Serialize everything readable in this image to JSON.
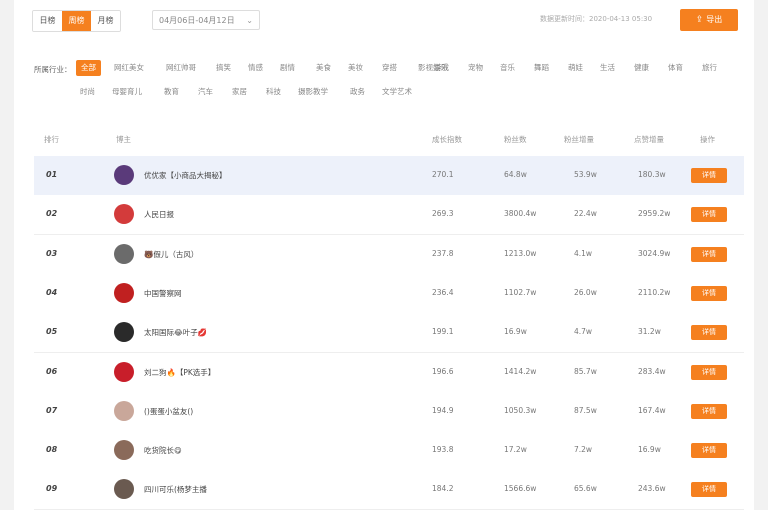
{
  "toolbar": {
    "tabs": [
      {
        "label": "日榜",
        "active": false
      },
      {
        "label": "周榜",
        "active": true
      },
      {
        "label": "月榜",
        "active": false
      }
    ],
    "date_range": "04月06日-04月12日",
    "update_time": "数据更新时间：2020-04-13 05:30",
    "export_label": "导出"
  },
  "filters": {
    "label": "所属行业：",
    "chips": [
      {
        "label": "全部",
        "active": true
      },
      {
        "label": "网红美女"
      },
      {
        "label": "网红帅哥"
      },
      {
        "label": "搞笑"
      },
      {
        "label": "情感"
      },
      {
        "label": "剧情"
      },
      {
        "label": "美食"
      },
      {
        "label": "美妆"
      },
      {
        "label": "穿搭"
      },
      {
        "label": "影视娱乐"
      },
      {
        "label": "游戏"
      },
      {
        "label": "宠物"
      },
      {
        "label": "音乐"
      },
      {
        "label": "舞蹈"
      },
      {
        "label": "萌娃"
      },
      {
        "label": "生活"
      },
      {
        "label": "健康"
      },
      {
        "label": "体育"
      },
      {
        "label": "旅行"
      },
      {
        "label": "时尚"
      },
      {
        "label": "母婴育儿"
      },
      {
        "label": "教育"
      },
      {
        "label": "汽车"
      },
      {
        "label": "家居"
      },
      {
        "label": "科技"
      },
      {
        "label": "摄影教学"
      },
      {
        "label": "政务"
      },
      {
        "label": "文学艺术"
      }
    ]
  },
  "table": {
    "headers": [
      "排行",
      "博主",
      "成长指数",
      "粉丝数",
      "粉丝增量",
      "点赞增量",
      "操作"
    ],
    "detail_label": "详情",
    "rows": [
      {
        "rank": "01",
        "name": "优优家【小商品大揭秘】",
        "growth": "270.1",
        "fans": "64.8w",
        "fan_inc": "53.9w",
        "like_inc": "180.3w",
        "avatar_color": "#5a3a7a"
      },
      {
        "rank": "02",
        "name": "人民日报",
        "growth": "269.3",
        "fans": "3800.4w",
        "fan_inc": "22.4w",
        "like_inc": "2959.2w",
        "avatar_color": "#d33b3b"
      },
      {
        "rank": "03",
        "name": "🐻假儿（古风）",
        "growth": "237.8",
        "fans": "1213.0w",
        "fan_inc": "4.1w",
        "like_inc": "3024.9w",
        "avatar_color": "#6b6b6b"
      },
      {
        "rank": "04",
        "name": "中国警察网",
        "growth": "236.4",
        "fans": "1102.7w",
        "fan_inc": "26.0w",
        "like_inc": "2110.2w",
        "avatar_color": "#c02020"
      },
      {
        "rank": "05",
        "name": "太阳国际😂叶子💋",
        "growth": "199.1",
        "fans": "16.9w",
        "fan_inc": "4.7w",
        "like_inc": "31.2w",
        "avatar_color": "#2a2a2a"
      },
      {
        "rank": "06",
        "name": "刘二狗🔥【PK选手】",
        "growth": "196.6",
        "fans": "1414.2w",
        "fan_inc": "85.7w",
        "like_inc": "283.4w",
        "avatar_color": "#c81e2a"
      },
      {
        "rank": "07",
        "name": "()蛋蛋小盆友()",
        "growth": "194.9",
        "fans": "1050.3w",
        "fan_inc": "87.5w",
        "like_inc": "167.4w",
        "avatar_color": "#c9a79a"
      },
      {
        "rank": "08",
        "name": "吃货院长😋",
        "growth": "193.8",
        "fans": "17.2w",
        "fan_inc": "7.2w",
        "like_inc": "16.9w",
        "avatar_color": "#8a6a5a"
      },
      {
        "rank": "09",
        "name": "四川可乐(杨梦主播",
        "growth": "184.2",
        "fans": "1566.6w",
        "fan_inc": "65.6w",
        "like_inc": "243.6w",
        "avatar_color": "#6a5a50"
      }
    ]
  }
}
